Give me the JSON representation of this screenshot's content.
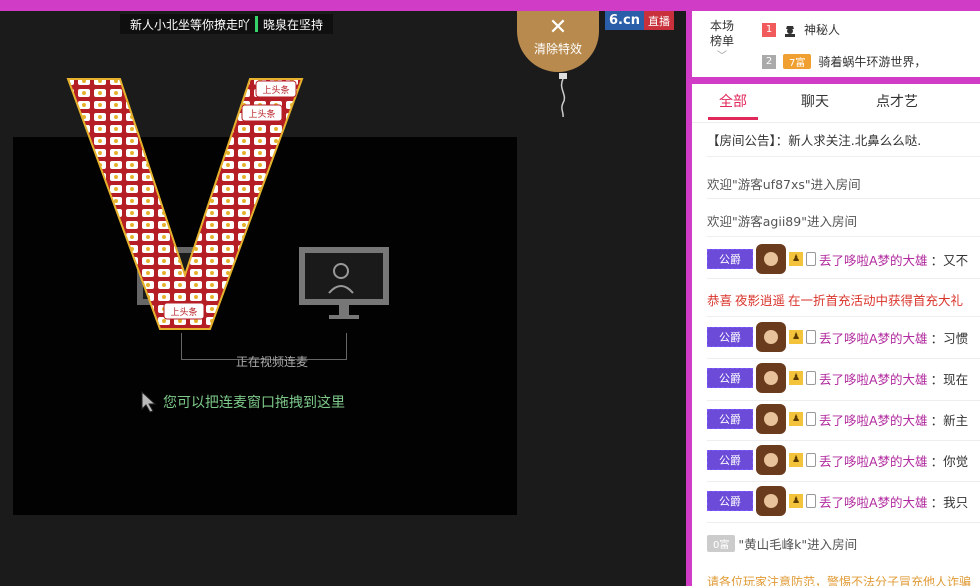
{
  "ticker": {
    "left": "新人小北坐等你撩走吖",
    "right": "晓泉在坚持"
  },
  "video": {
    "connect_label": "正在视频连麦",
    "hint": "您可以把连麦窗口拖拽到这里",
    "sticker_text": "上头条"
  },
  "clear_effects": {
    "label": "清除特效"
  },
  "brand": {
    "site": "6.cn",
    "live": "直播"
  },
  "ranking": {
    "title_line1": "本场",
    "title_line2": "榜单",
    "rows": [
      {
        "num": "1",
        "name": "神秘人"
      },
      {
        "num": "2",
        "badge": "7富",
        "name": "骑着蜗牛环游世界，"
      }
    ]
  },
  "chat": {
    "tabs": [
      "全部",
      "聊天",
      "点才艺"
    ],
    "announcement": "【房间公告】：新人求关注.北鼻么么哒.",
    "welcome1": "欢迎\"游客uf87xs\"进入房间",
    "welcome2": "欢迎\"游客agii89\"进入房间",
    "guild": "公爵",
    "user": "丢了哆啦A梦的大雄",
    "system_msg": {
      "prefix": "恭喜",
      "user": "夜影逍遥",
      "text": "在一折首充活动中获得首充大礼"
    },
    "messages": [
      "：又不",
      "：习惯",
      "：现在",
      "：新主",
      "：你觉",
      "：我只"
    ],
    "last_badge": "0富",
    "last_welcome": "\"黄山毛峰k\"进入房间",
    "footer": "请各位玩家注意防范，警惕不法分子冒充他人诈骗"
  },
  "colors": {
    "accent": "#d13cc7",
    "active_tab": "#e0285a",
    "username": "#b12a9e",
    "hint_text": "#7dc98a"
  }
}
